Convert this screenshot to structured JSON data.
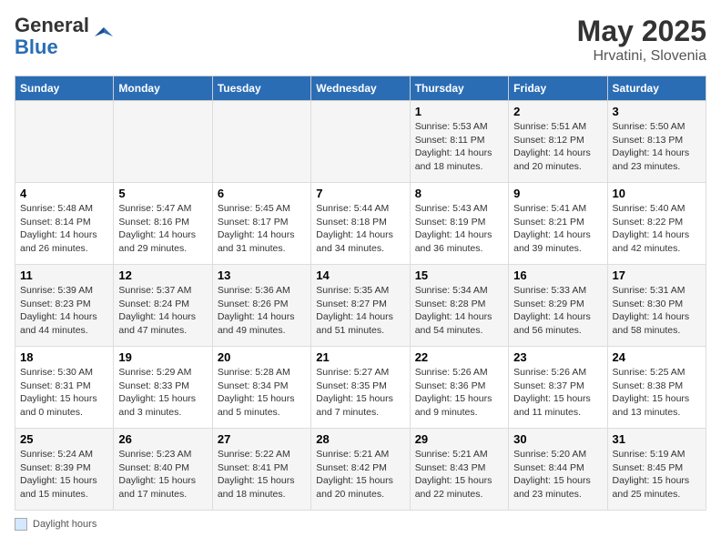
{
  "logo": {
    "general": "General",
    "blue": "Blue"
  },
  "title": "May 2025",
  "subtitle": "Hrvatini, Slovenia",
  "days_of_week": [
    "Sunday",
    "Monday",
    "Tuesday",
    "Wednesday",
    "Thursday",
    "Friday",
    "Saturday"
  ],
  "footer_label": "Daylight hours",
  "weeks": [
    [
      {
        "day": "",
        "info": ""
      },
      {
        "day": "",
        "info": ""
      },
      {
        "day": "",
        "info": ""
      },
      {
        "day": "",
        "info": ""
      },
      {
        "day": "1",
        "info": "Sunrise: 5:53 AM\nSunset: 8:11 PM\nDaylight: 14 hours and 18 minutes."
      },
      {
        "day": "2",
        "info": "Sunrise: 5:51 AM\nSunset: 8:12 PM\nDaylight: 14 hours and 20 minutes."
      },
      {
        "day": "3",
        "info": "Sunrise: 5:50 AM\nSunset: 8:13 PM\nDaylight: 14 hours and 23 minutes."
      }
    ],
    [
      {
        "day": "4",
        "info": "Sunrise: 5:48 AM\nSunset: 8:14 PM\nDaylight: 14 hours and 26 minutes."
      },
      {
        "day": "5",
        "info": "Sunrise: 5:47 AM\nSunset: 8:16 PM\nDaylight: 14 hours and 29 minutes."
      },
      {
        "day": "6",
        "info": "Sunrise: 5:45 AM\nSunset: 8:17 PM\nDaylight: 14 hours and 31 minutes."
      },
      {
        "day": "7",
        "info": "Sunrise: 5:44 AM\nSunset: 8:18 PM\nDaylight: 14 hours and 34 minutes."
      },
      {
        "day": "8",
        "info": "Sunrise: 5:43 AM\nSunset: 8:19 PM\nDaylight: 14 hours and 36 minutes."
      },
      {
        "day": "9",
        "info": "Sunrise: 5:41 AM\nSunset: 8:21 PM\nDaylight: 14 hours and 39 minutes."
      },
      {
        "day": "10",
        "info": "Sunrise: 5:40 AM\nSunset: 8:22 PM\nDaylight: 14 hours and 42 minutes."
      }
    ],
    [
      {
        "day": "11",
        "info": "Sunrise: 5:39 AM\nSunset: 8:23 PM\nDaylight: 14 hours and 44 minutes."
      },
      {
        "day": "12",
        "info": "Sunrise: 5:37 AM\nSunset: 8:24 PM\nDaylight: 14 hours and 47 minutes."
      },
      {
        "day": "13",
        "info": "Sunrise: 5:36 AM\nSunset: 8:26 PM\nDaylight: 14 hours and 49 minutes."
      },
      {
        "day": "14",
        "info": "Sunrise: 5:35 AM\nSunset: 8:27 PM\nDaylight: 14 hours and 51 minutes."
      },
      {
        "day": "15",
        "info": "Sunrise: 5:34 AM\nSunset: 8:28 PM\nDaylight: 14 hours and 54 minutes."
      },
      {
        "day": "16",
        "info": "Sunrise: 5:33 AM\nSunset: 8:29 PM\nDaylight: 14 hours and 56 minutes."
      },
      {
        "day": "17",
        "info": "Sunrise: 5:31 AM\nSunset: 8:30 PM\nDaylight: 14 hours and 58 minutes."
      }
    ],
    [
      {
        "day": "18",
        "info": "Sunrise: 5:30 AM\nSunset: 8:31 PM\nDaylight: 15 hours and 0 minutes."
      },
      {
        "day": "19",
        "info": "Sunrise: 5:29 AM\nSunset: 8:33 PM\nDaylight: 15 hours and 3 minutes."
      },
      {
        "day": "20",
        "info": "Sunrise: 5:28 AM\nSunset: 8:34 PM\nDaylight: 15 hours and 5 minutes."
      },
      {
        "day": "21",
        "info": "Sunrise: 5:27 AM\nSunset: 8:35 PM\nDaylight: 15 hours and 7 minutes."
      },
      {
        "day": "22",
        "info": "Sunrise: 5:26 AM\nSunset: 8:36 PM\nDaylight: 15 hours and 9 minutes."
      },
      {
        "day": "23",
        "info": "Sunrise: 5:26 AM\nSunset: 8:37 PM\nDaylight: 15 hours and 11 minutes."
      },
      {
        "day": "24",
        "info": "Sunrise: 5:25 AM\nSunset: 8:38 PM\nDaylight: 15 hours and 13 minutes."
      }
    ],
    [
      {
        "day": "25",
        "info": "Sunrise: 5:24 AM\nSunset: 8:39 PM\nDaylight: 15 hours and 15 minutes."
      },
      {
        "day": "26",
        "info": "Sunrise: 5:23 AM\nSunset: 8:40 PM\nDaylight: 15 hours and 17 minutes."
      },
      {
        "day": "27",
        "info": "Sunrise: 5:22 AM\nSunset: 8:41 PM\nDaylight: 15 hours and 18 minutes."
      },
      {
        "day": "28",
        "info": "Sunrise: 5:21 AM\nSunset: 8:42 PM\nDaylight: 15 hours and 20 minutes."
      },
      {
        "day": "29",
        "info": "Sunrise: 5:21 AM\nSunset: 8:43 PM\nDaylight: 15 hours and 22 minutes."
      },
      {
        "day": "30",
        "info": "Sunrise: 5:20 AM\nSunset: 8:44 PM\nDaylight: 15 hours and 23 minutes."
      },
      {
        "day": "31",
        "info": "Sunrise: 5:19 AM\nSunset: 8:45 PM\nDaylight: 15 hours and 25 minutes."
      }
    ]
  ]
}
